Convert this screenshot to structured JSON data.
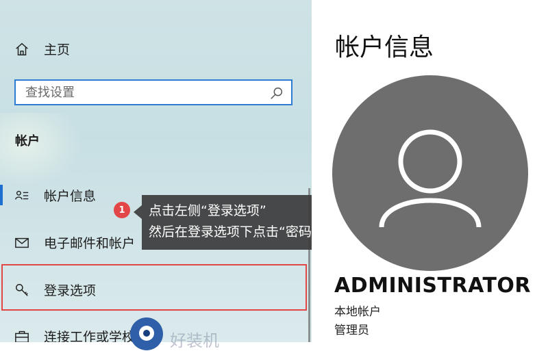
{
  "sidebar": {
    "home_label": "主页",
    "search": {
      "placeholder": "查找设置",
      "value": ""
    },
    "section_title": "帐户",
    "items": [
      {
        "label": "帐户信息",
        "icon": "account-info-icon"
      },
      {
        "label": "电子邮件和帐户",
        "icon": "mail-icon"
      },
      {
        "label": "登录选项",
        "icon": "key-icon"
      },
      {
        "label": "连接工作或学校帐户",
        "icon": "briefcase-icon"
      }
    ]
  },
  "callout": {
    "badge": "1",
    "line1": "点击左侧“登录选项”",
    "line2": "然后在登录选项下点击“密码”"
  },
  "account": {
    "title": "帐户信息",
    "name": "ADMINISTRATOR",
    "type": "本地帐户",
    "role": "管理员"
  },
  "watermark": "好装机",
  "colors": {
    "accent": "#1f6fd1",
    "highlight": "#e24545",
    "callout_bg": "#3c3c3c",
    "avatar_bg": "#6e6e6e"
  }
}
